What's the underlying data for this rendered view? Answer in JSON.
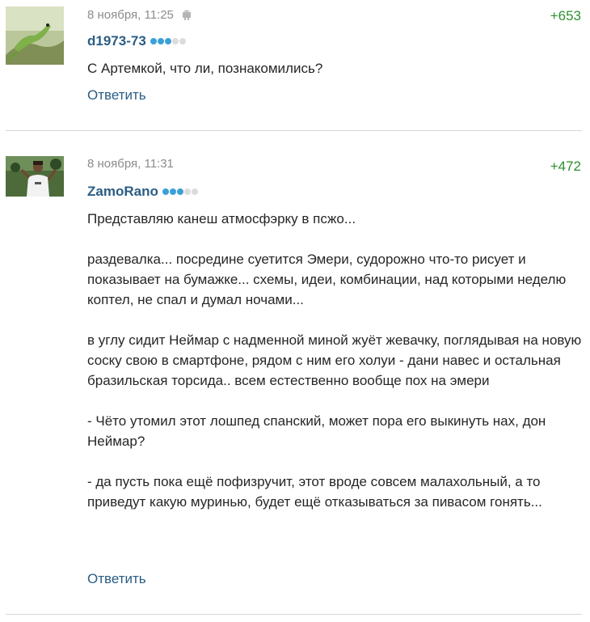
{
  "comments": [
    {
      "date": "8 ноября, 11:25",
      "device_icon": "android-icon",
      "author": "d1973-73",
      "rating": "+653",
      "level_filled": 3,
      "level_total": 5,
      "paragraphs": [
        "С Артемкой, что ли, познакомились?"
      ],
      "reply_label": "Ответить"
    },
    {
      "date": "8 ноября, 11:31",
      "author": "ZamoRano",
      "rating": "+472",
      "level_filled": 3,
      "level_total": 5,
      "paragraphs": [
        "Представляю канеш атмосфэрку в псжо...",
        "раздевалка... посредине суетится Эмери, судорожно что-то рисует и показывает на бумажке... схемы, идеи, комбинации, над которыми неделю коптел, не спал и думал ночами...",
        "в углу сидит Неймар с надменной миной жуёт жевачку, поглядывая на новую соску свою в смартфоне, рядом с ним его холуи - дани навес и остальная бразильская торсида.. всем естественно вообще пох на эмери",
        "- Чёто утомил этот лошпед спанский, может пора его выкинуть нах, дон Неймар?",
        "- да пусть пока ещё пофизручит, этот вроде совсем малахольный, а то приведут какую муринью, будет ещё отказываться за пивасом гонять..."
      ],
      "reply_label": "Ответить"
    }
  ],
  "colors": {
    "author": "#2a5d85",
    "rating": "#2f8f2f",
    "meta": "#8c8c8c",
    "level_dot_on": "#3aa0d8",
    "level_dot_off": "#dcdcdc"
  }
}
